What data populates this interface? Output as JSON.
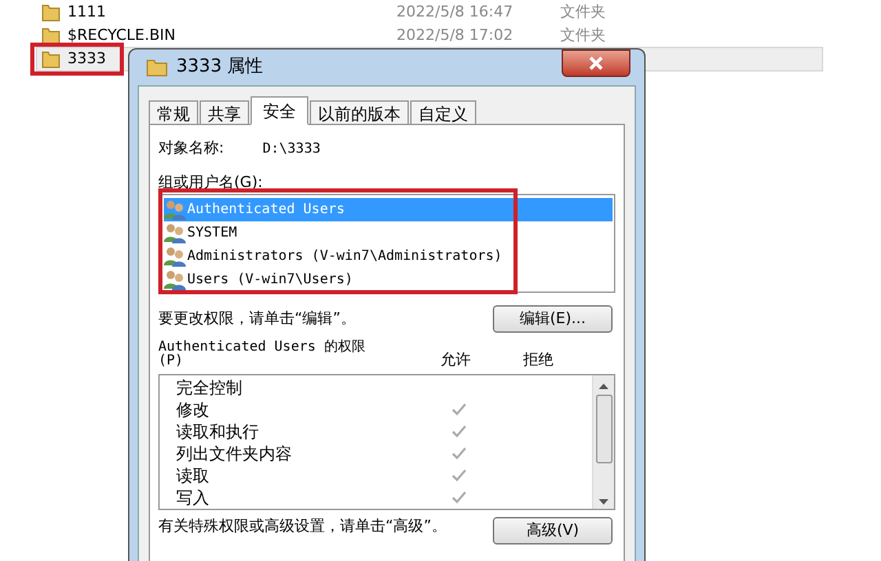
{
  "explorer": {
    "rows": [
      {
        "name": "1111",
        "date": "2022/5/8 16:47",
        "type": "文件夹",
        "selected": false
      },
      {
        "name": "$RECYCLE.BIN",
        "date": "2022/5/8 17:02",
        "type": "文件夹",
        "selected": false
      },
      {
        "name": "3333",
        "selected": true
      }
    ]
  },
  "dialog": {
    "title": "3333 属性",
    "tabs": [
      {
        "label": "常规",
        "selected": false
      },
      {
        "label": "共享",
        "selected": false
      },
      {
        "label": "安全",
        "selected": true
      },
      {
        "label": "以前的版本",
        "selected": false
      },
      {
        "label": "自定义",
        "selected": false
      }
    ],
    "object_label": "对象名称:",
    "object_value": "D:\\3333",
    "group_label": "组或用户名(G):",
    "users": [
      {
        "name": "Authenticated Users",
        "selected": true
      },
      {
        "name": "SYSTEM",
        "selected": false
      },
      {
        "name": "Administrators (V-win7\\Administrators)",
        "selected": false
      },
      {
        "name": "Users (V-win7\\Users)",
        "selected": false
      }
    ],
    "edit_hint": "要更改权限，请单击“编辑”。",
    "edit_button": "编辑(E)...",
    "perm_title": "Authenticated Users 的权限",
    "perm_key": "(P)",
    "allow_header": "允许",
    "deny_header": "拒绝",
    "permissions": [
      {
        "name": "完全控制",
        "allow": false,
        "deny": false
      },
      {
        "name": "修改",
        "allow": true,
        "deny": false
      },
      {
        "name": "读取和执行",
        "allow": true,
        "deny": false
      },
      {
        "name": "列出文件夹内容",
        "allow": true,
        "deny": false
      },
      {
        "name": "读取",
        "allow": true,
        "deny": false
      },
      {
        "name": "写入",
        "allow": true,
        "deny": false
      }
    ],
    "advanced_hint": "有关特殊权限或高级设置，请单击“高级”。",
    "advanced_button": "高级(V)"
  }
}
